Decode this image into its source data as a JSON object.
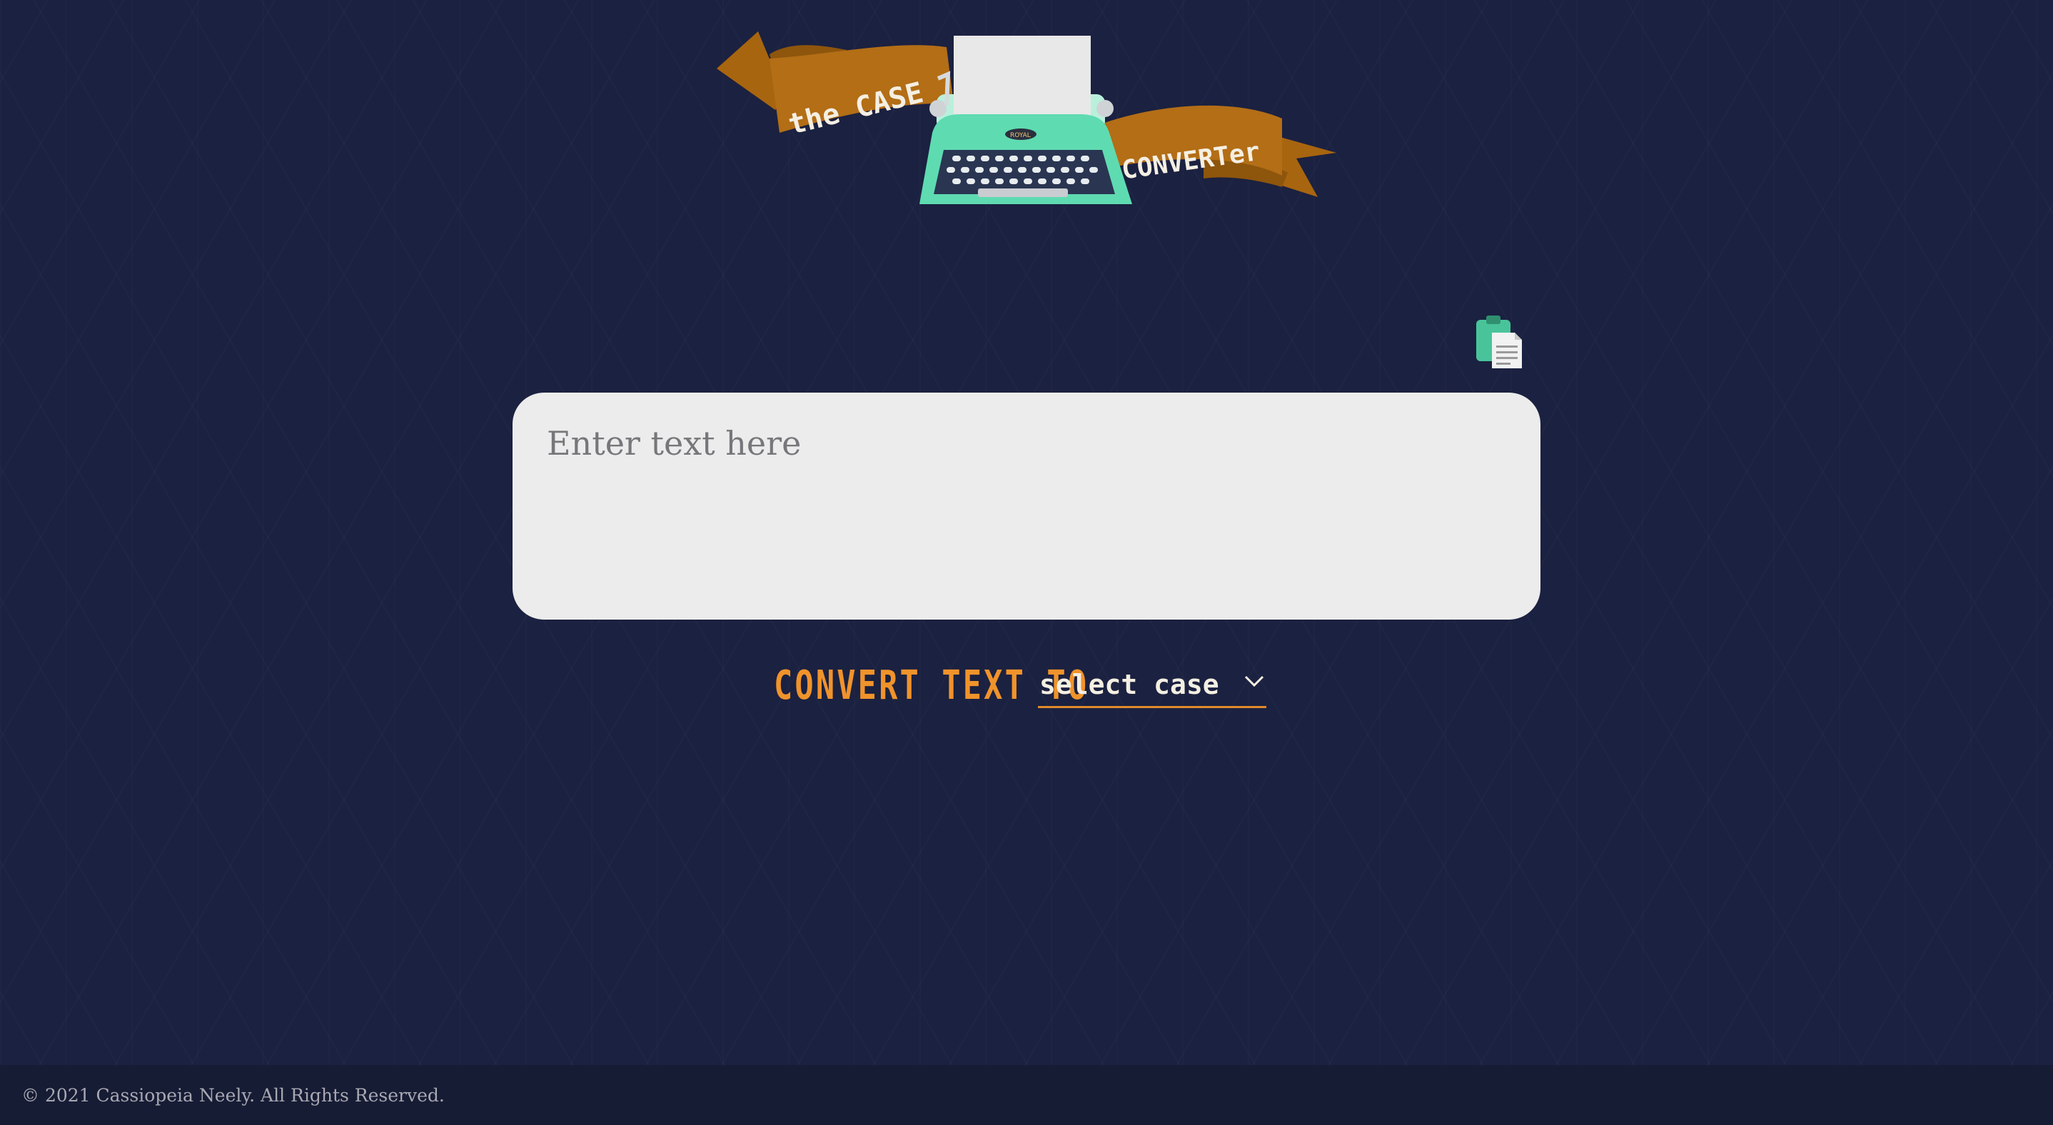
{
  "header": {
    "logo_text_left": "the CASE",
    "logo_text_right": "CONVERTer",
    "typewriter_brand": "ROYAL",
    "logo_icon": "typewriter-icon"
  },
  "toolbar": {
    "copy_icon": "clipboard-copy-icon"
  },
  "editor": {
    "placeholder": "Enter text here",
    "value": ""
  },
  "converter": {
    "label": "CONVERT TEXT TO",
    "selected_case": "select case",
    "dropdown_icon": "chevron-down-icon"
  },
  "footer": {
    "copyright": "© 2021 Cassiopeia Neely. All Rights Reserved."
  },
  "colors": {
    "background": "#1b2140",
    "accent_orange": "#f0932b",
    "banner_orange": "#b36e16",
    "typewriter_teal": "#5fdbb1",
    "input_bg": "#ececec"
  }
}
